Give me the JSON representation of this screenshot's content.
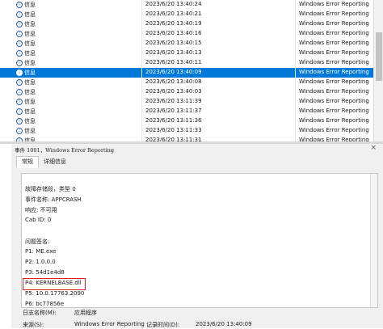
{
  "event_list": {
    "rows": [
      {
        "level": "信息",
        "datetime": "2023/6/20 13:40:24",
        "source": "Windows Error Reporting",
        "selected": false
      },
      {
        "level": "信息",
        "datetime": "2023/6/20 13:40:21",
        "source": "Windows Error Reporting",
        "selected": false
      },
      {
        "level": "信息",
        "datetime": "2023/6/20 13:40:19",
        "source": "Windows Error Reporting",
        "selected": false
      },
      {
        "level": "信息",
        "datetime": "2023/6/20 13:40:16",
        "source": "Windows Error Reporting",
        "selected": false
      },
      {
        "level": "信息",
        "datetime": "2023/6/20 13:40:15",
        "source": "Windows Error Reporting",
        "selected": false
      },
      {
        "level": "信息",
        "datetime": "2023/6/20 13:40:13",
        "source": "Windows Error Reporting",
        "selected": false
      },
      {
        "level": "信息",
        "datetime": "2023/6/20 13:40:11",
        "source": "Windows Error Reporting",
        "selected": false
      },
      {
        "level": "信息",
        "datetime": "2023/6/20 13:40:09",
        "source": "Windows Error Reporting",
        "selected": true
      },
      {
        "level": "信息",
        "datetime": "2023/6/20 13:40:08",
        "source": "Windows Error Reporting",
        "selected": false
      },
      {
        "level": "信息",
        "datetime": "2023/6/20 13:40:03",
        "source": "Windows Error Reporting",
        "selected": false
      },
      {
        "level": "信息",
        "datetime": "2023/6/20 13:11:39",
        "source": "Windows Error Reporting",
        "selected": false
      },
      {
        "level": "信息",
        "datetime": "2023/6/20 13:11:37",
        "source": "Windows Error Reporting",
        "selected": false
      },
      {
        "level": "信息",
        "datetime": "2023/6/20 13:11:36",
        "source": "Windows Error Reporting",
        "selected": false
      },
      {
        "level": "信息",
        "datetime": "2023/6/20 13:11:33",
        "source": "Windows Error Reporting",
        "selected": false
      },
      {
        "level": "信息",
        "datetime": "2023/6/20 13:11:31",
        "source": "Windows Error Reporting",
        "selected": false
      }
    ]
  },
  "detail": {
    "title": "事件 1001，Windows Error Reporting",
    "close_label": "×",
    "tabs": [
      {
        "label": "常规",
        "active": true
      },
      {
        "label": "详细信息",
        "active": false
      }
    ],
    "description_lines": [
      "故障存储段，类型 0",
      "事件名称: APPCRASH",
      "响应: 不可用",
      "Cab ID: 0",
      "",
      "问题签名:",
      "P1: ME.exe",
      "P2: 1.0.0.0",
      "P3: 54d1e4d8",
      "P4: KERNELBASE.dll",
      "P5: 10.0.17763.2090",
      "P6: bc77856e"
    ],
    "log_name_label": "日志名称(M):",
    "log_name_value": "应用程序",
    "source_label": "来源(S):",
    "source_value": "Windows Error Reporting",
    "logged_label": "记录时间(D):",
    "logged_value": "2023/6/20 13:40:09"
  },
  "colors": {
    "selection": "#0078d7",
    "highlight_border": "#e02020"
  }
}
